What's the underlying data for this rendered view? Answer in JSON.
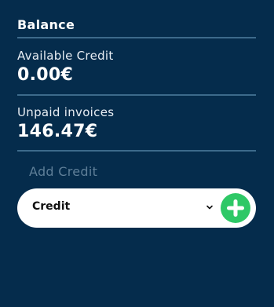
{
  "balance": {
    "title": "Balance",
    "available_credit_label": "Available Credit",
    "available_credit_value": "0.00€",
    "unpaid_invoices_label": "Unpaid invoices",
    "unpaid_invoices_value": "146.47€"
  },
  "add_credit": {
    "placeholder": "Add Credit",
    "select_value": "Credit",
    "dropdown_icon": "chevron-down-icon",
    "add_icon": "plus-icon",
    "add_button_color": "#2ec866"
  },
  "colors": {
    "background": "#052c4c",
    "divider": "#3d6a8b",
    "muted_text": "#5f7f98"
  }
}
